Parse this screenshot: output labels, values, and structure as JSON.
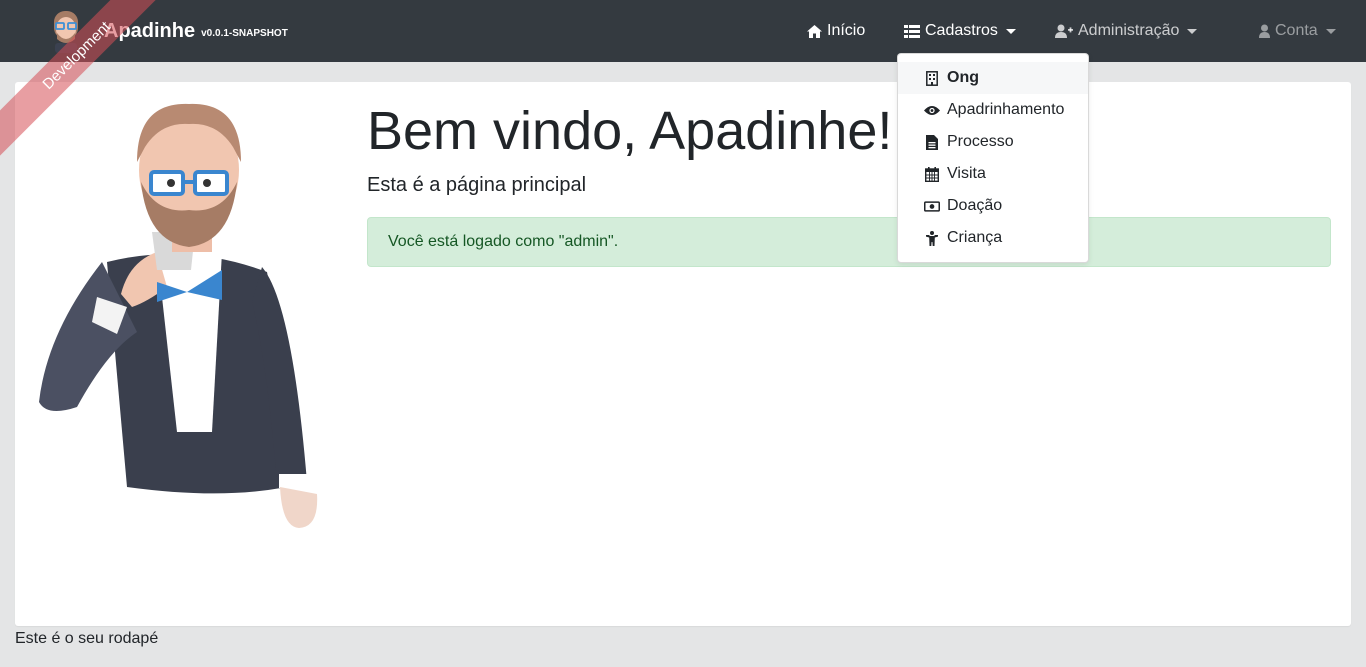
{
  "navbar": {
    "brand_title": "Apadinhe",
    "brand_version": "v0.0.1-SNAPSHOT",
    "ribbon_label": "Development",
    "items": [
      {
        "label": "Início",
        "icon": "home-icon"
      },
      {
        "label": "Cadastros",
        "icon": "list-icon"
      },
      {
        "label": "Administração",
        "icon": "user-plus-icon"
      },
      {
        "label": "Conta",
        "icon": "user-icon"
      }
    ]
  },
  "dropdown": {
    "items": [
      {
        "label": "Ong",
        "icon": "building-icon",
        "active": true
      },
      {
        "label": "Apadrinhamento",
        "icon": "eye-icon"
      },
      {
        "label": "Processo",
        "icon": "file-icon"
      },
      {
        "label": "Visita",
        "icon": "calendar-icon"
      },
      {
        "label": "Doação",
        "icon": "money-icon"
      },
      {
        "label": "Criança",
        "icon": "child-icon"
      }
    ]
  },
  "main": {
    "title": "Bem vindo, Apadinhe!",
    "subtitle": "Esta é a página principal",
    "alert": "Você está logado como \"admin\"."
  },
  "footer": {
    "text": "Este é o seu rodapé"
  },
  "colors": {
    "navbar_bg": "#343a40",
    "alert_bg": "#d4edda",
    "alert_text": "#155724",
    "ribbon": "#d64e56"
  }
}
